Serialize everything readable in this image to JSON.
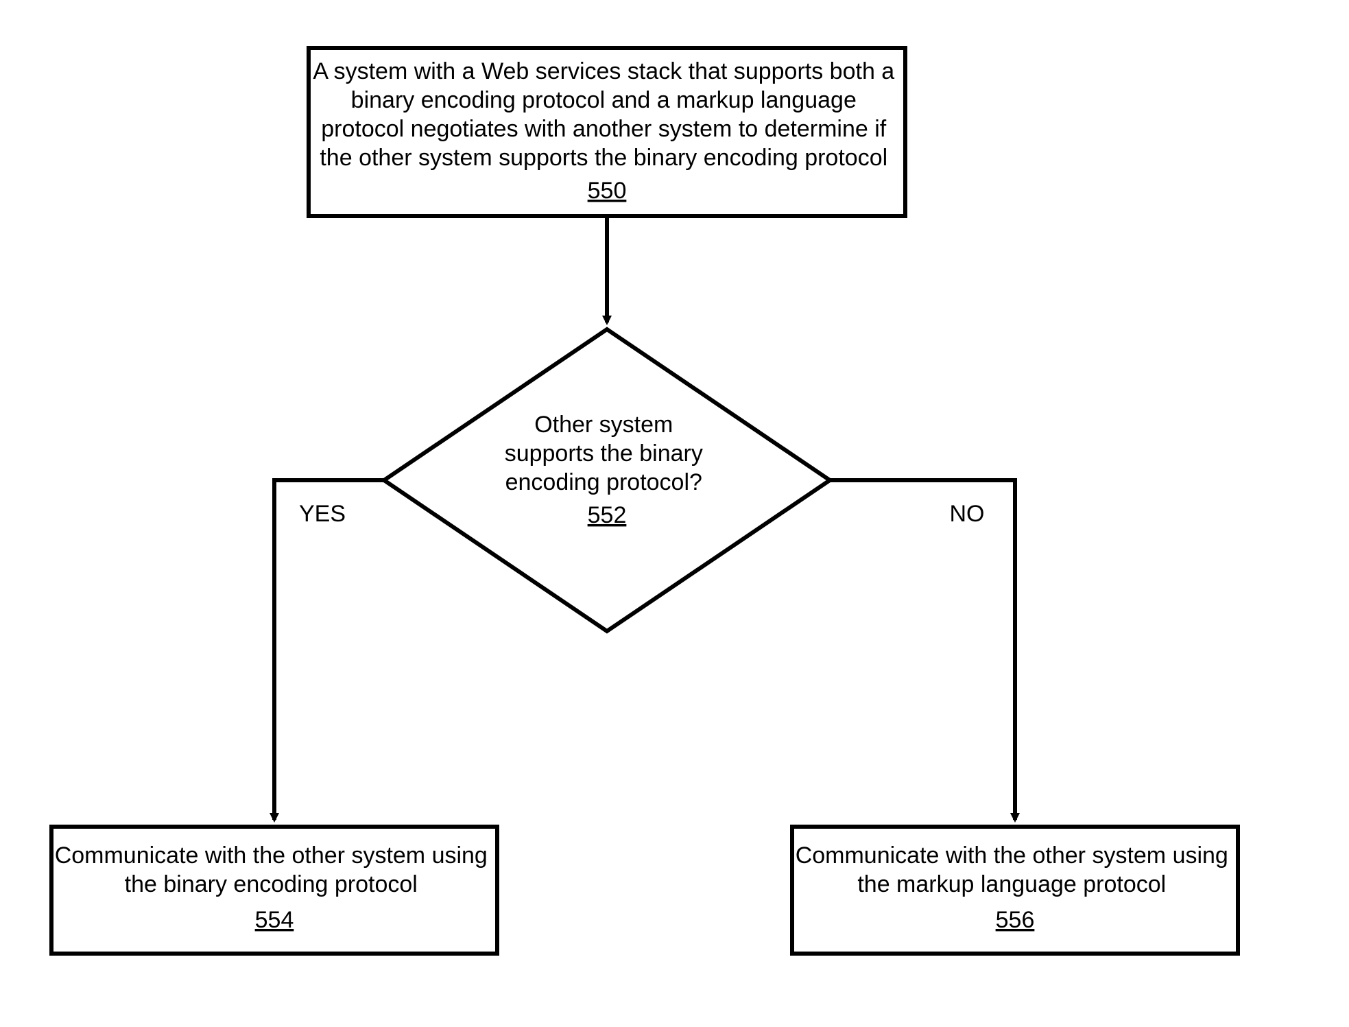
{
  "chart_data": {
    "type": "flowchart",
    "nodes": [
      {
        "id": "550",
        "shape": "rectangle",
        "lines": [
          "A system with a Web services stack that supports both a",
          "binary encoding protocol and a markup language",
          "protocol negotiates with another system to determine if",
          "the other system supports the binary encoding protocol"
        ],
        "ref": "550"
      },
      {
        "id": "552",
        "shape": "diamond",
        "lines": [
          "Other system",
          "supports the binary",
          "encoding protocol?"
        ],
        "ref": "552"
      },
      {
        "id": "554",
        "shape": "rectangle",
        "lines": [
          "Communicate with the other system using",
          "the binary encoding protocol"
        ],
        "ref": "554"
      },
      {
        "id": "556",
        "shape": "rectangle",
        "lines": [
          "Communicate with the other system using",
          "the markup language protocol"
        ],
        "ref": "556"
      }
    ],
    "edges": [
      {
        "from": "550",
        "to": "552",
        "label": ""
      },
      {
        "from": "552",
        "to": "554",
        "label": "YES"
      },
      {
        "from": "552",
        "to": "556",
        "label": "NO"
      }
    ],
    "branch_labels": {
      "yes": "YES",
      "no": "NO"
    }
  }
}
